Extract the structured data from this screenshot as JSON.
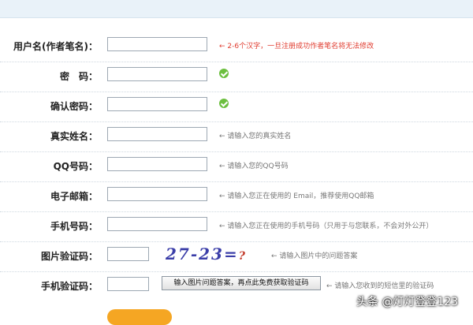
{
  "form": {
    "rows": [
      {
        "label": "用户名(作者笔名)：",
        "hint": "2-6个汉字，一旦注册成功作者笔名将无法修改"
      },
      {
        "label": "密　码："
      },
      {
        "label": "确认密码："
      },
      {
        "label": "真实姓名：",
        "hint": "请输入您的真实姓名"
      },
      {
        "label": "QQ号码：",
        "hint": "请输入您的QQ号码"
      },
      {
        "label": "电子邮箱：",
        "hint": "请输入您正在使用的 Email，推荐使用QQ邮箱"
      },
      {
        "label": "手机号码：",
        "hint": "请输入您正在使用的手机号码（只用于与您联系，不会对外公开）"
      },
      {
        "label": "图片验证码：",
        "captcha": "27-23=",
        "captcha_q": "?",
        "hint": "请输入图片中的问题答案"
      },
      {
        "label": "手机验证码：",
        "button": "输入图片问题答案，再点此免费获取验证码",
        "hint": "请输入您收到的短信里的验证码"
      }
    ]
  },
  "watermark": "头条 @灯灯登登123",
  "colors": {
    "error": "#e03c2f",
    "ok": "#6cbf3f",
    "submit": "#f5a623"
  }
}
